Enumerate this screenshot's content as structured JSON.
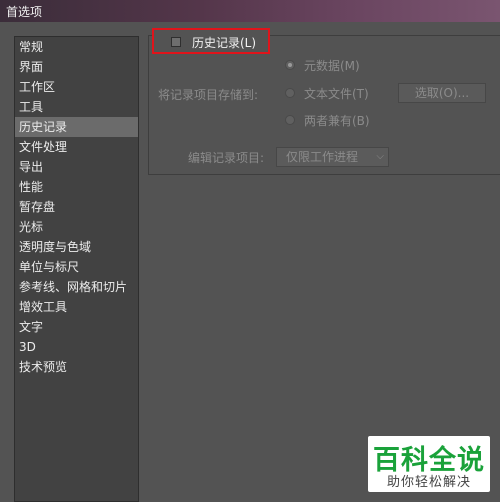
{
  "window": {
    "title": "首选项"
  },
  "sidebar": {
    "items": [
      {
        "label": "常规"
      },
      {
        "label": "界面"
      },
      {
        "label": "工作区"
      },
      {
        "label": "工具"
      },
      {
        "label": "历史记录"
      },
      {
        "label": "文件处理"
      },
      {
        "label": "导出"
      },
      {
        "label": "性能"
      },
      {
        "label": "暂存盘"
      },
      {
        "label": "光标"
      },
      {
        "label": "透明度与色域"
      },
      {
        "label": "单位与标尺"
      },
      {
        "label": "参考线、网格和切片"
      },
      {
        "label": "增效工具"
      },
      {
        "label": "文字"
      },
      {
        "label": "3D"
      },
      {
        "label": "技术预览"
      }
    ],
    "active_index": 4
  },
  "history": {
    "checkbox_label": "历史记录(L)",
    "checked": false,
    "store_label": "将记录项目存储到:",
    "options": [
      "元数据(M)",
      "文本文件(T)",
      "两者兼有(B)"
    ],
    "selected_option": 0,
    "choose_button": "选取(O)...",
    "edit_label": "编辑记录项目:",
    "edit_value": "仅限工作进程"
  },
  "watermark": {
    "title": "百科全说",
    "subtitle": "助你轻松解决"
  },
  "colors": {
    "highlight_border": "#e0141b",
    "watermark_green": "#1aa23a"
  }
}
